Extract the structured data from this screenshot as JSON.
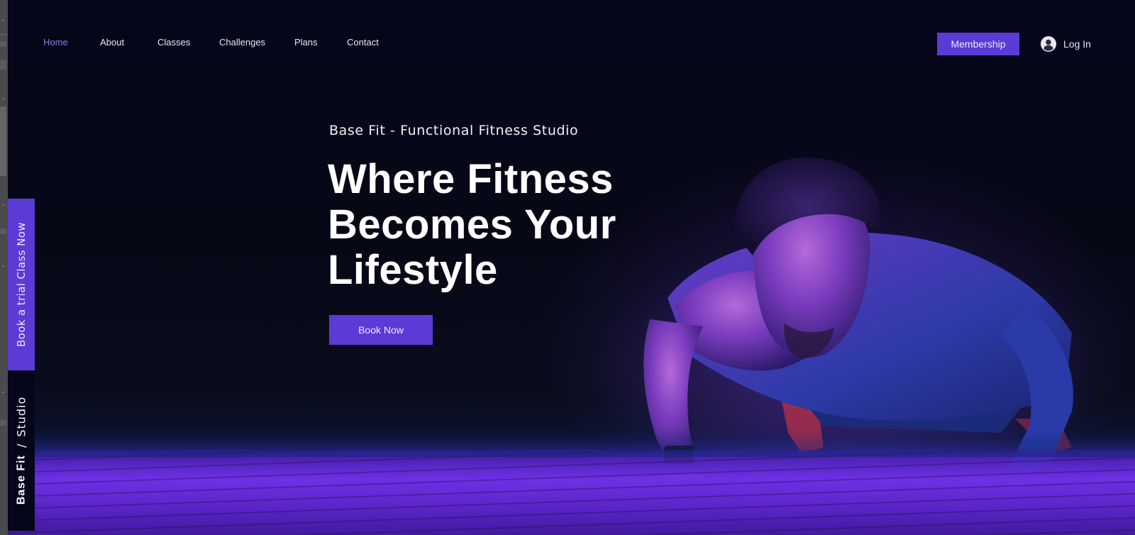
{
  "nav": {
    "items": [
      {
        "label": "Home",
        "active": true
      },
      {
        "label": "About",
        "active": false
      },
      {
        "label": "Classes",
        "active": false
      },
      {
        "label": "Challenges",
        "active": false
      },
      {
        "label": "Plans",
        "active": false
      },
      {
        "label": "Contact",
        "active": false
      }
    ]
  },
  "header": {
    "membership_label": "Membership",
    "login_label": "Log In",
    "login_icon": "user-avatar-icon"
  },
  "hero": {
    "tagline": "Base Fit - Functional Fitness Studio",
    "headline_lines": [
      "Where Fitness",
      "Becomes Your",
      "Lifestyle"
    ],
    "cta_label": "Book Now",
    "image": "man-doing-pushup-purple-lighting"
  },
  "side": {
    "trial_label": "Book a trial Class Now",
    "brand_bold": "Base Fit",
    "brand_sep": "/",
    "brand_light": "Studio"
  },
  "colors": {
    "accent": "#5b3ad6",
    "active_nav": "#8f7be0",
    "background": "#05061a",
    "text": "#e9e8f2"
  }
}
